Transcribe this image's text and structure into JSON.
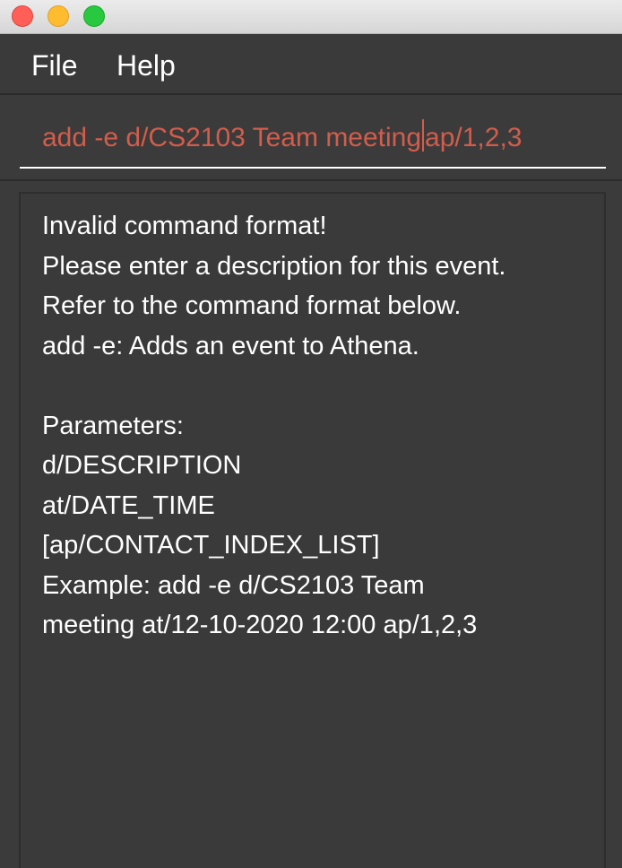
{
  "window": {
    "buttons": {
      "close": "close",
      "minimize": "minimize",
      "maximize": "maximize"
    }
  },
  "menu": {
    "items": [
      "File",
      "Help"
    ]
  },
  "command_box": {
    "text_before_caret": "add -e d/CS2103 Team meeting",
    "text_after_caret": "ap/1,2,3",
    "text_color": "#d25d4c"
  },
  "result_display": {
    "lines": [
      "Invalid command format!",
      "Please enter a description for this event.",
      "Refer to the command format below.",
      "add -e: Adds an event to Athena.",
      "",
      "Parameters:",
      "d/DESCRIPTION",
      "at/DATE_TIME",
      "[ap/CONTACT_INDEX_LIST]",
      "Example: add -e d/CS2103 Team",
      "meeting at/12-10-2020 12:00 ap/1,2,3"
    ]
  }
}
